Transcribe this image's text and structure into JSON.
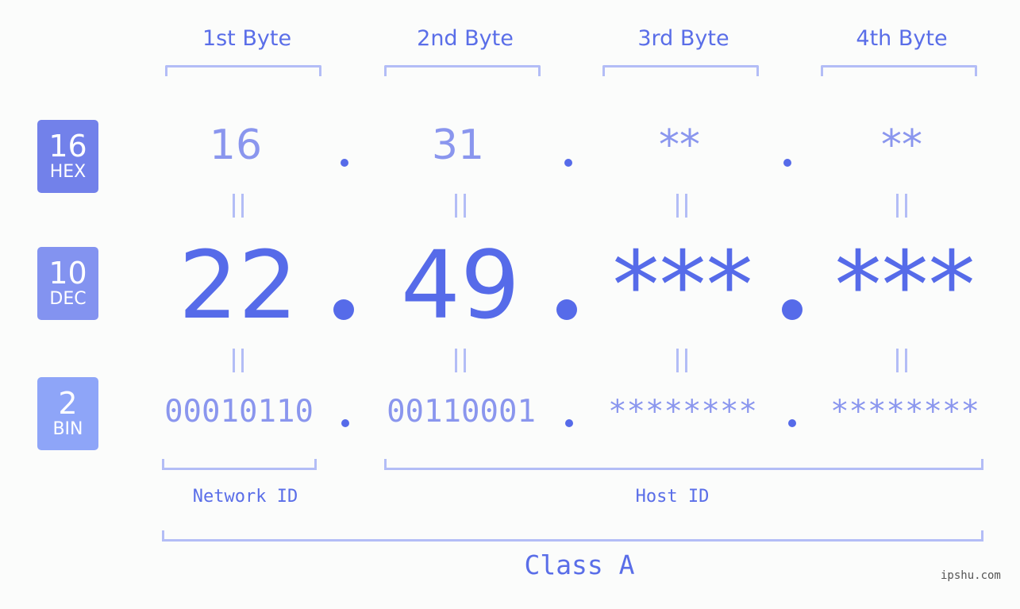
{
  "headers": [
    "1st Byte",
    "2nd Byte",
    "3rd Byte",
    "4th Byte"
  ],
  "badges": {
    "hex": {
      "num": "16",
      "label": "HEX",
      "color": "#7281ea"
    },
    "dec": {
      "num": "10",
      "label": "DEC",
      "color": "#8393f0"
    },
    "bin": {
      "num": "2",
      "label": "BIN",
      "color": "#8ea5f8"
    }
  },
  "hex": [
    "16",
    "31",
    "**",
    "**"
  ],
  "dec": [
    "22",
    "49",
    "***",
    "***"
  ],
  "bin": [
    "00010110",
    "00110001",
    "********",
    "********"
  ],
  "equals": "=",
  "labels": {
    "network": "Network ID",
    "host": "Host ID",
    "class": "Class A"
  },
  "watermark": "ipshu.com",
  "colors": {
    "accent": "#566be9",
    "light": "#8a96ee",
    "bracket": "#b3bdf6"
  }
}
